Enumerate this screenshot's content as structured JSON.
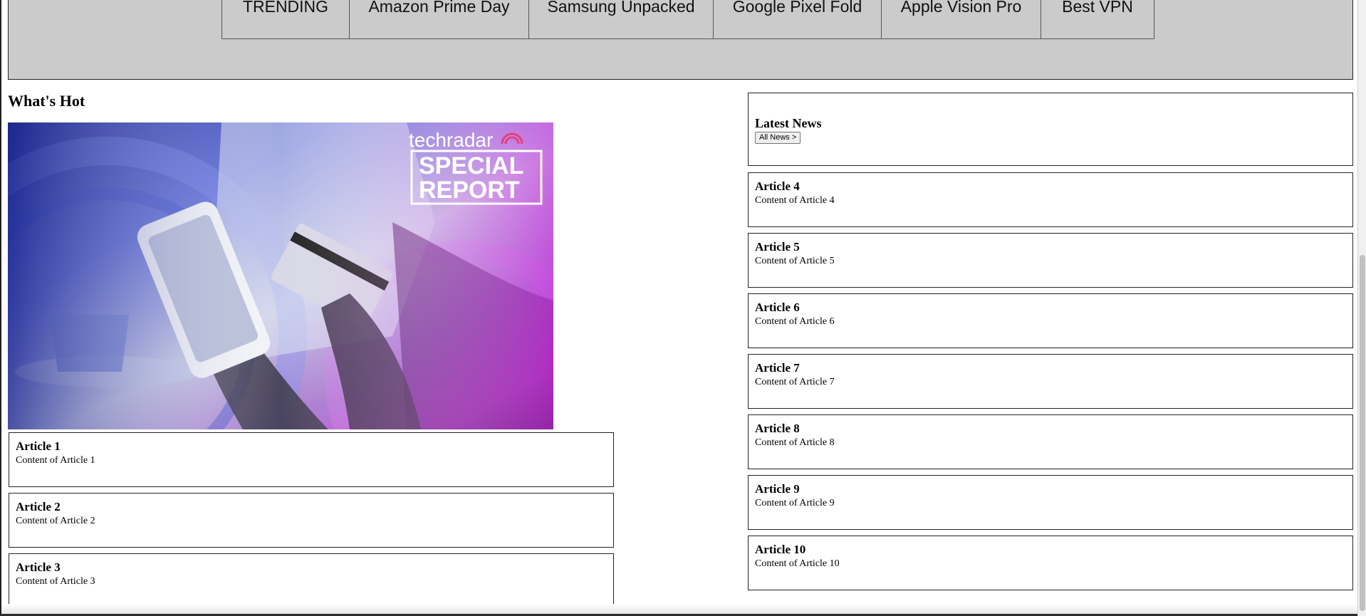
{
  "nav": {
    "items": [
      "TRENDING",
      "Amazon Prime Day",
      "Samsung Unpacked",
      "Google Pixel Fold",
      "Apple Vision Pro",
      "Best VPN"
    ]
  },
  "whats_hot": {
    "title": "What's Hot",
    "hero": {
      "brand": "techradar",
      "badge_line1": "SPECIAL",
      "badge_line2": "REPORT"
    },
    "articles": [
      {
        "title": "Article 1",
        "content": "Content of Article 1"
      },
      {
        "title": "Article 2",
        "content": "Content of Article 2"
      },
      {
        "title": "Article 3",
        "content": "Content of Article 3"
      }
    ]
  },
  "latest_news": {
    "title": "Latest News",
    "all_news_label": "All News >",
    "articles": [
      {
        "title": "Article 4",
        "content": "Content of Article 4"
      },
      {
        "title": "Article 5",
        "content": "Content of Article 5"
      },
      {
        "title": "Article 6",
        "content": "Content of Article 6"
      },
      {
        "title": "Article 7",
        "content": "Content of Article 7"
      },
      {
        "title": "Article 8",
        "content": "Content of Article 8"
      },
      {
        "title": "Article 9",
        "content": "Content of Article 9"
      },
      {
        "title": "Article 10",
        "content": "Content of Article 10"
      }
    ]
  },
  "colors": {
    "nav_background": "#cbcbcb",
    "brand_pink": "#e43f7a"
  }
}
